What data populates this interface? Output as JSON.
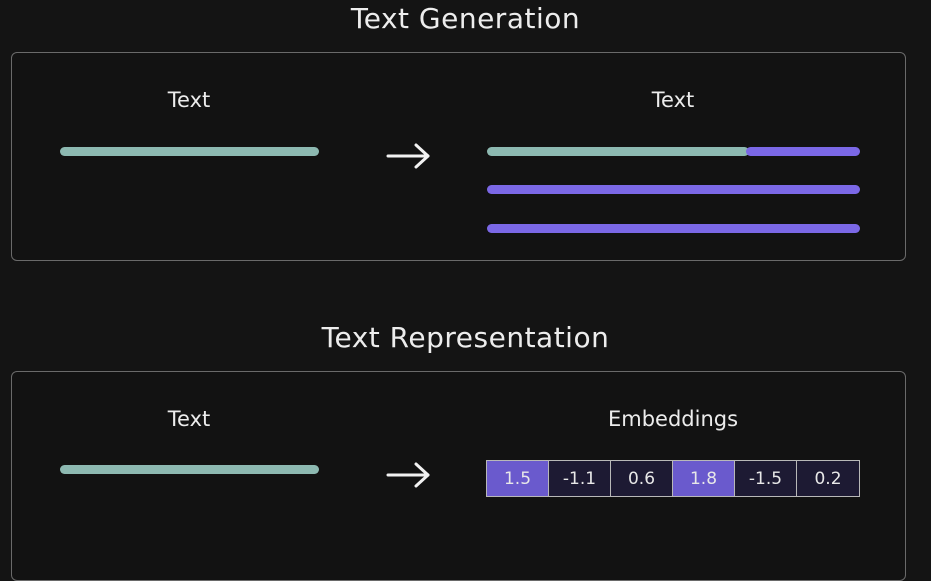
{
  "generation": {
    "title": "Text Generation",
    "input_label": "Text",
    "output_label": "Text"
  },
  "representation": {
    "title": "Text Representation",
    "input_label": "Text",
    "output_label": "Embeddings",
    "embeddings": [
      "1.5",
      "-1.1",
      "0.6",
      "1.8",
      "-1.5",
      "0.2"
    ]
  },
  "colors": {
    "input_text": "#8db9b1",
    "generated_text": "#7b68e6",
    "embedding_high": "#6a5acd",
    "embedding_low": "#1d1a33"
  },
  "icons": [
    "right-arrow-icon"
  ]
}
